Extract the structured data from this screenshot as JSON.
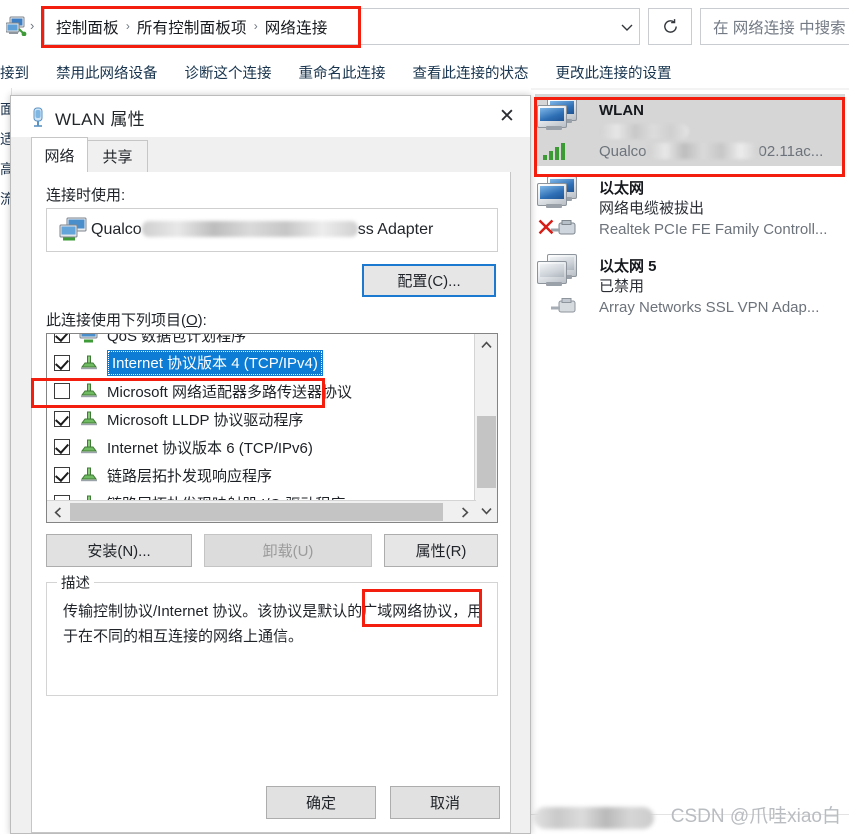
{
  "window": {
    "address_icon": "network-connections-icon",
    "breadcrumbs": [
      "控制面板",
      "所有控制面板项",
      "网络连接"
    ],
    "breadcrumb_separator": "›",
    "dropdown_icon": "chevron-down-icon",
    "refresh_icon": "refresh-icon",
    "search_placeholder": "在 网络连接 中搜索"
  },
  "command_bar": {
    "items": [
      {
        "label": "接到"
      },
      {
        "label": "禁用此网络设备"
      },
      {
        "label": "诊断这个连接"
      },
      {
        "label": "重命名此连接"
      },
      {
        "label": "查看此连接的状态"
      },
      {
        "label": "更改此连接的设置"
      }
    ]
  },
  "adapters": [
    {
      "name": "WLAN",
      "status": "",
      "driver_prefix": "Qualco",
      "driver_suffix": "02.11ac...",
      "icon": "wireless-adapter-icon",
      "selected": true,
      "status_redacted": true
    },
    {
      "name": "以太网",
      "status": "网络电缆被拔出",
      "driver_prefix": "Realtek PCIe FE Family Controll...",
      "driver_suffix": "",
      "icon": "ethernet-disconnected-icon",
      "selected": false,
      "status_redacted": false
    },
    {
      "name": "以太网 5",
      "status": "已禁用",
      "driver_prefix": "Array Networks SSL VPN Adap...",
      "driver_suffix": "",
      "icon": "ethernet-disabled-icon",
      "selected": false,
      "status_redacted": false
    }
  ],
  "watermark": "CSDN @爪哇xiao白",
  "dialog": {
    "icon": "network-properties-icon",
    "title": "WLAN 属性",
    "close_icon": "close-icon",
    "tabs": [
      {
        "label": "网络",
        "active": true
      },
      {
        "label": "共享",
        "active": false
      }
    ],
    "connect_using_label": "连接时使用:",
    "adapter_icon": "network-adapter-icon",
    "adapter_prefix": "Qualco",
    "adapter_suffix": "ss Adapter",
    "configure_button": "配置(C)...",
    "items_label_prefix": "此连接使用下列项目(",
    "items_label_accel": "O",
    "items_label_suffix": "):",
    "items": [
      {
        "label": "QoS 数据包计划程序",
        "checked": true,
        "selected": false,
        "icon": "monitor-service-icon",
        "clipped": true
      },
      {
        "label": "Internet 协议版本 4 (TCP/IPv4)",
        "checked": true,
        "selected": true,
        "icon": "protocol-icon",
        "clipped": false
      },
      {
        "label": "Microsoft 网络适配器多路传送器协议",
        "checked": false,
        "selected": false,
        "icon": "protocol-icon",
        "clipped": false
      },
      {
        "label": "Microsoft LLDP 协议驱动程序",
        "checked": true,
        "selected": false,
        "icon": "protocol-icon",
        "clipped": false
      },
      {
        "label": "Internet 协议版本 6 (TCP/IPv6)",
        "checked": true,
        "selected": false,
        "icon": "protocol-icon",
        "clipped": false
      },
      {
        "label": "链路层拓扑发现响应程序",
        "checked": true,
        "selected": false,
        "icon": "protocol-icon",
        "clipped": false
      },
      {
        "label": "链路层拓扑发现映射器 I/O 驱动程序",
        "checked": true,
        "selected": false,
        "icon": "protocol-icon",
        "clipped": false
      }
    ],
    "scroll": {
      "up_arrow_icon": "chevron-up-icon",
      "down_arrow_icon": "chevron-down-icon",
      "left_arrow_icon": "chevron-left-icon",
      "right_arrow_icon": "chevron-right-icon"
    },
    "install_button": "安装(N)...",
    "uninstall_button": "卸载(U)",
    "properties_button": "属性(R)",
    "description_legend": "描述",
    "description_text": "传输控制协议/Internet 协议。该协议是默认的广域网络协议，用于在不同的相互连接的网络上通信。",
    "ok_button": "确定",
    "cancel_button": "取消"
  },
  "annotations": {
    "highlight_color": "#f41e0e",
    "boxes": [
      {
        "name": "address-bar-highlight"
      },
      {
        "name": "wlan-adapter-highlight"
      },
      {
        "name": "tcpipv4-item-highlight"
      },
      {
        "name": "properties-button-highlight"
      }
    ]
  },
  "colors": {
    "selection_blue": "#0c7cd5",
    "focus_border": "#1b79d0",
    "annotation_red": "#f41e0e"
  }
}
